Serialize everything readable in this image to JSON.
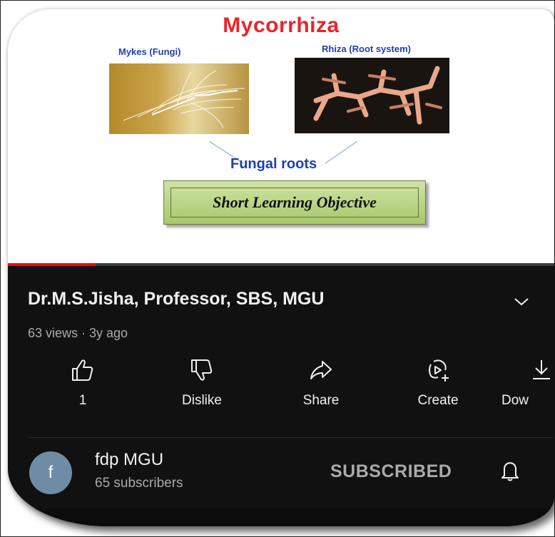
{
  "slide": {
    "title": "Mycorrhiza",
    "left_caption": "Mykes (Fungi)",
    "right_caption": "Rhiza (Root system)",
    "center_caption": "Fungal roots",
    "objective_label": "Short Learning Objective"
  },
  "player": {
    "progress_fraction": 0.16
  },
  "video": {
    "title": "Dr.M.S.Jisha, Professor, SBS, MGU",
    "meta": "63 views · 3y ago"
  },
  "actions": [
    {
      "label": "1",
      "icon": "thumbs-up-icon"
    },
    {
      "label": "Dislike",
      "icon": "thumbs-down-icon"
    },
    {
      "label": "Share",
      "icon": "share-icon"
    },
    {
      "label": "Create",
      "icon": "create-icon"
    },
    {
      "label": "Dow",
      "icon": "download-icon"
    }
  ],
  "channel": {
    "avatar_letter": "f",
    "name": "fdp MGU",
    "subscribers": "65 subscribers",
    "subscribe_state": "SUBSCRIBED"
  },
  "colors": {
    "title_red": "#e8252a",
    "caption_blue": "#1f3fae",
    "dark_bg": "#111111",
    "progress_red": "#ff0000"
  }
}
